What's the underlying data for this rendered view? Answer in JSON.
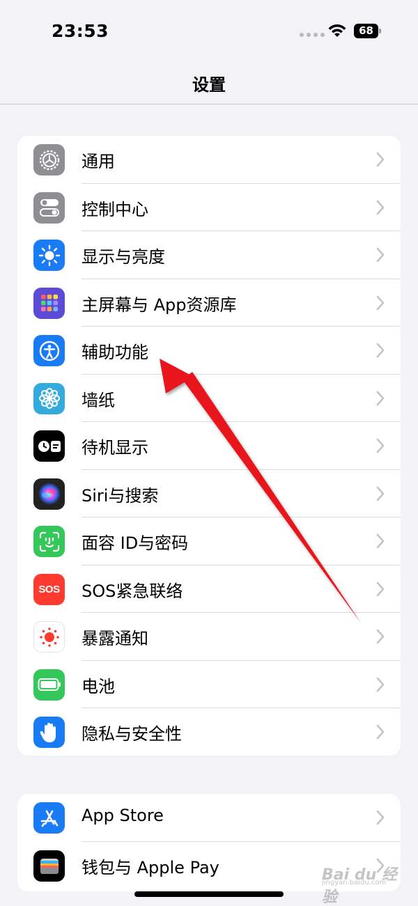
{
  "status_bar": {
    "time": "23:53",
    "battery": "68"
  },
  "nav": {
    "title": "设置"
  },
  "group1": [
    {
      "label": "通用",
      "icon": "gear-icon",
      "color": "#8e8e93"
    },
    {
      "label": "控制中心",
      "icon": "toggles-icon",
      "color": "#8e8e93"
    },
    {
      "label": "显示与亮度",
      "icon": "sun-icon",
      "color": "#1a7cf5"
    },
    {
      "label": "主屏幕与 App资源库",
      "icon": "app-grid-icon",
      "color": "#5b4bd6"
    },
    {
      "label": "辅助功能",
      "icon": "accessibility-icon",
      "color": "#1a7cf5"
    },
    {
      "label": "墙纸",
      "icon": "flower-icon",
      "color": "#35aadc"
    },
    {
      "label": "待机显示",
      "icon": "standby-icon",
      "color": "#000000"
    },
    {
      "label": "Siri与搜索",
      "icon": "siri-icon",
      "color": "#222222"
    },
    {
      "label": "面容 ID与密码",
      "icon": "face-id-icon",
      "color": "#34c759"
    },
    {
      "label": "SOS紧急联络",
      "icon": "sos-icon",
      "color": "#ff3b30"
    },
    {
      "label": "暴露通知",
      "icon": "exposure-icon",
      "color": "#ffffff"
    },
    {
      "label": "电池",
      "icon": "battery-icon",
      "color": "#34c759"
    },
    {
      "label": "隐私与安全性",
      "icon": "hand-icon",
      "color": "#1a7cf5"
    }
  ],
  "group2": [
    {
      "label": "App Store",
      "icon": "app-store-icon",
      "color": "#1a7cf5"
    },
    {
      "label": "钱包与 Apple Pay",
      "icon": "wallet-icon",
      "color": "#000000"
    }
  ],
  "watermark": {
    "main": "Bai du 经验",
    "sub": "jingyan.baidu.com"
  }
}
